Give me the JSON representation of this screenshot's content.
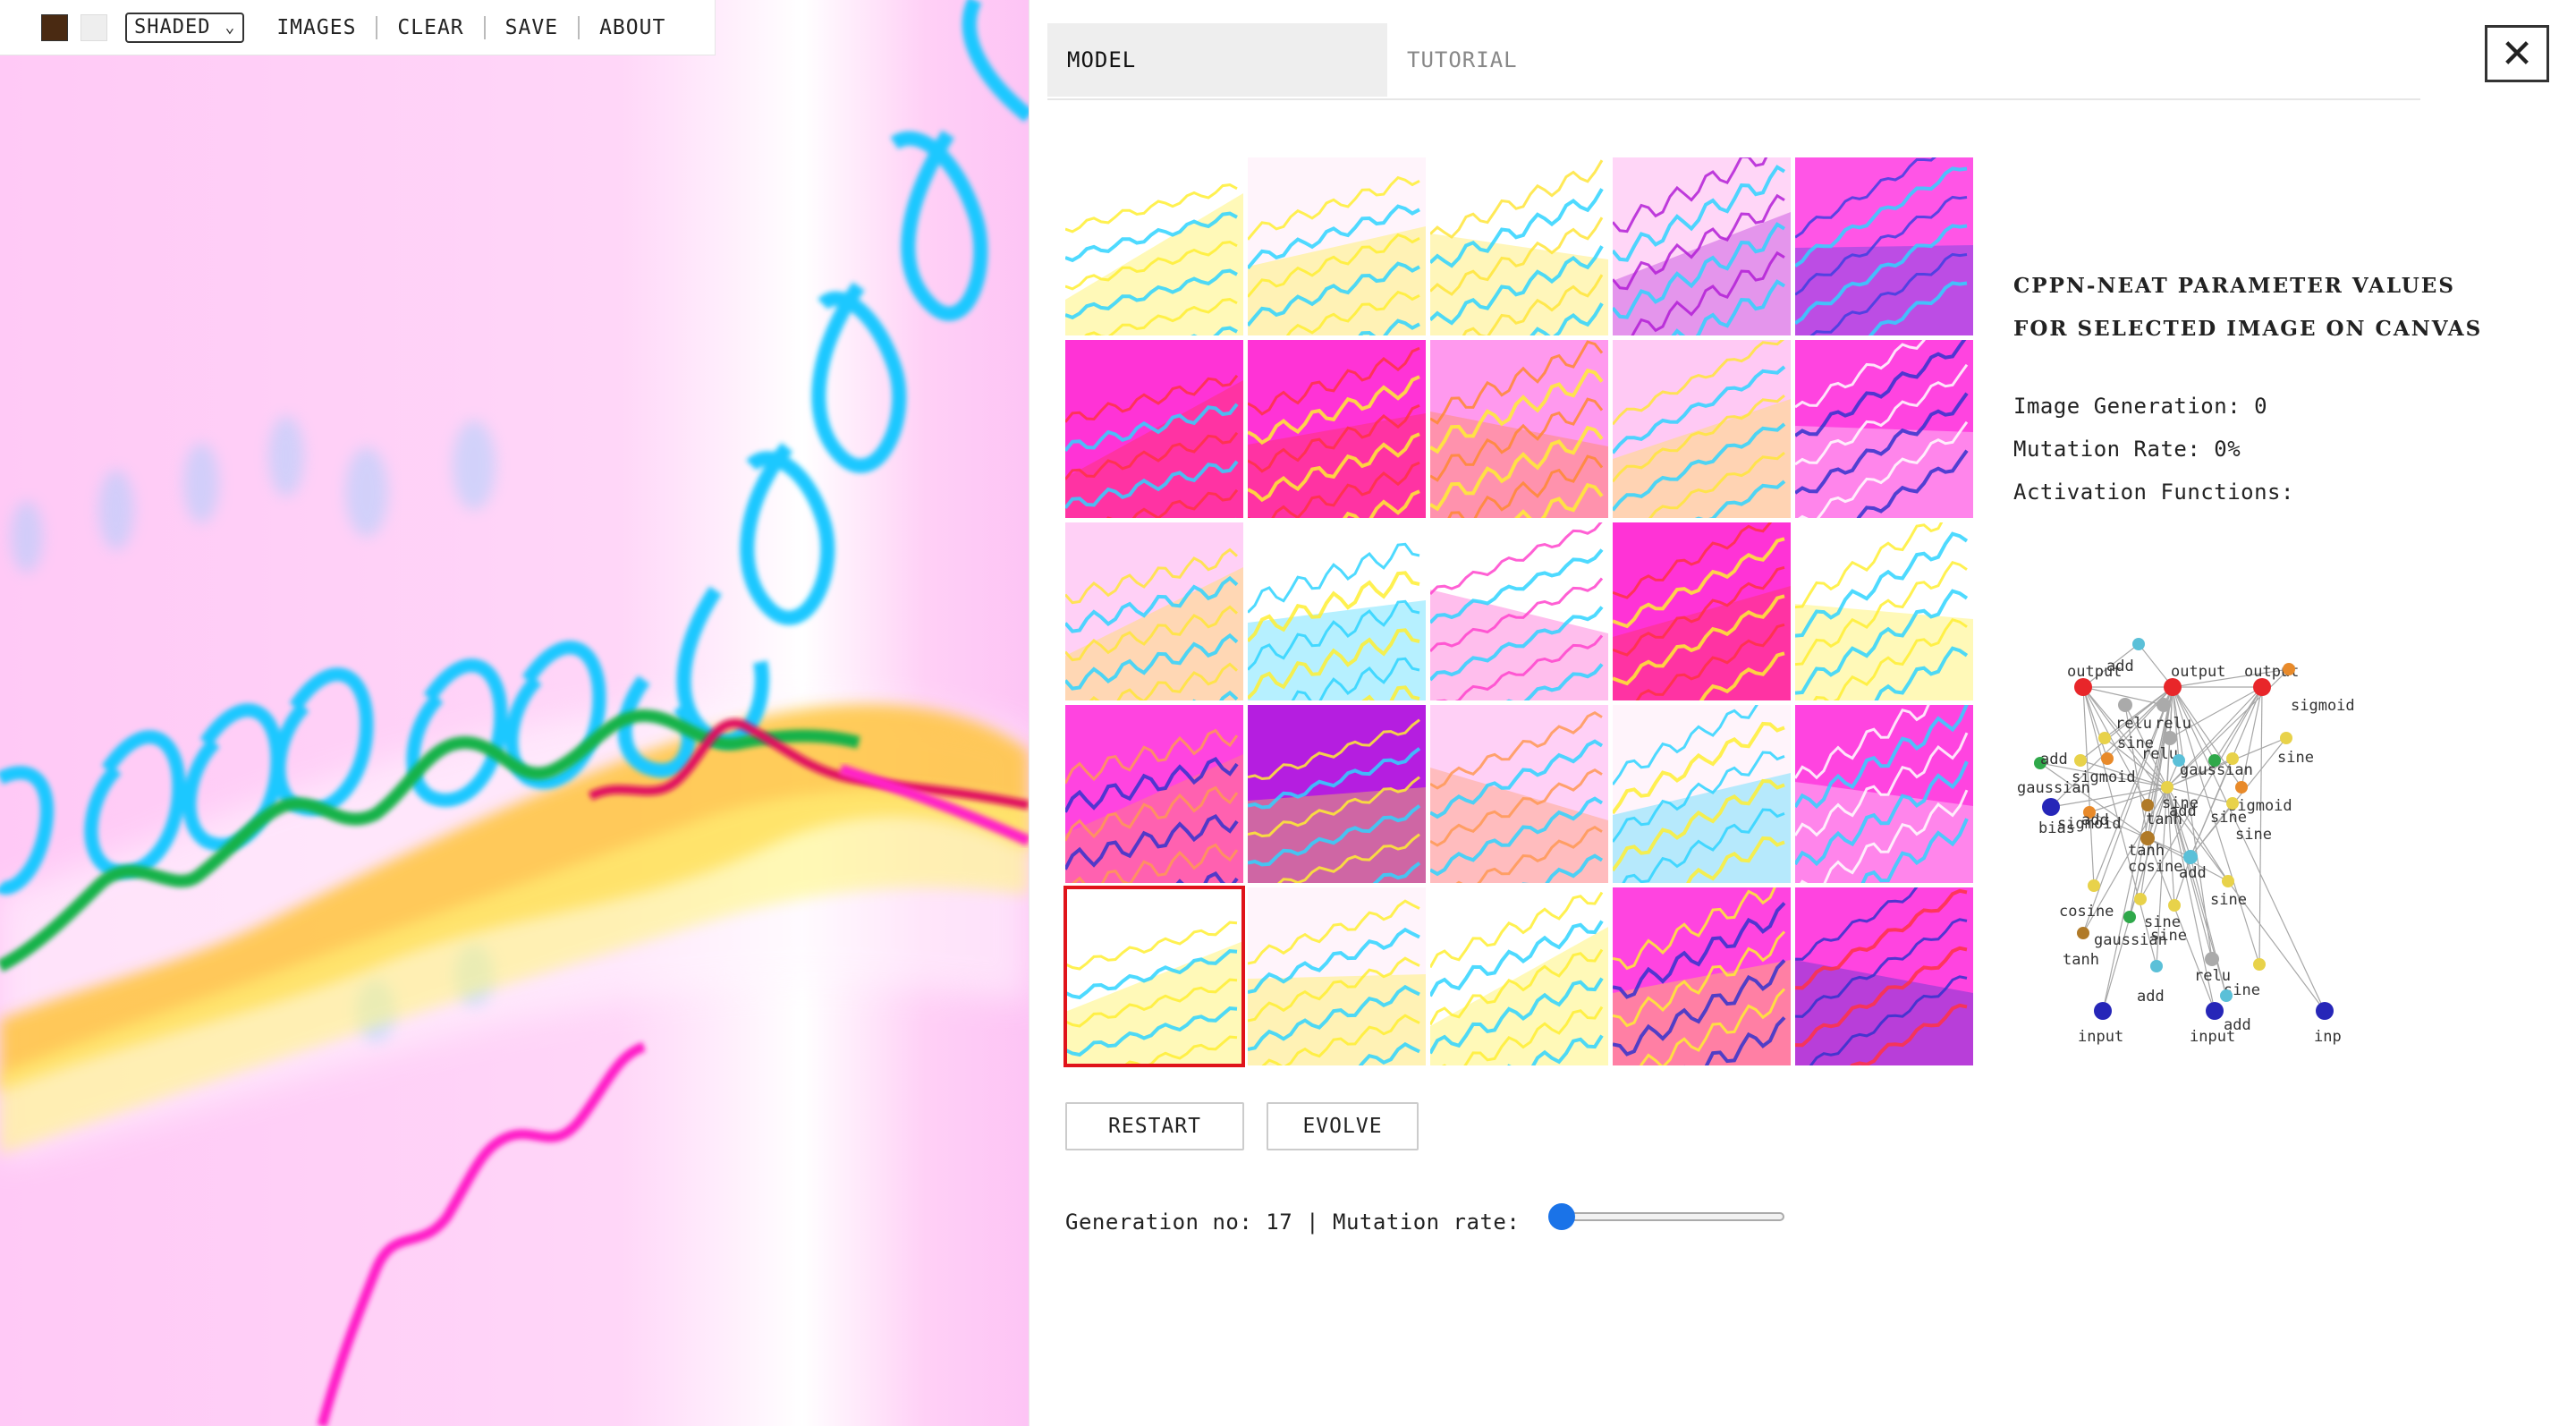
{
  "toolbar": {
    "colors": {
      "primary": "#4a2a12",
      "secondary": "#eeeeee"
    },
    "mode": "SHADED",
    "links": [
      "IMAGES",
      "CLEAR",
      "SAVE",
      "ABOUT"
    ]
  },
  "tabs": {
    "model": "MODEL",
    "tutorial": "TUTORIAL"
  },
  "close_label": "✕",
  "grid": {
    "rows": 5,
    "cols": 5,
    "selected_index": 20
  },
  "buttons": {
    "restart": "RESTART",
    "evolve": "EVOLVE"
  },
  "status": {
    "generation_label": "Generation no:",
    "generation": "17",
    "separator": "|",
    "mutation_label": "Mutation rate:",
    "mutation_slider_value": 0
  },
  "info": {
    "title_line1": "CPPN-NEAT PARAMETER VALUES",
    "title_line2": "FOR SELECTED IMAGE ON CANVAS",
    "image_generation": "Image Generation: 0",
    "mutation_rate": "Mutation Rate: 0%",
    "activation_functions": "Activation Functions:"
  },
  "network": {
    "labels": [
      "output",
      "add",
      "output",
      "output",
      "sigmoid",
      "relu",
      "relu",
      "sine",
      "relu",
      "sine",
      "gaussian",
      "sine",
      "sigmoid",
      "gaussian",
      "add",
      "add",
      "sine",
      "sigmoid",
      "bias",
      "sigmoid",
      "tanh",
      "sine",
      "tanh",
      "cosine",
      "add",
      "cosine",
      "sine",
      "gaussian",
      "sine",
      "tanh",
      "relu",
      "sine",
      "add",
      "add",
      "input",
      "input",
      "inp"
    ]
  },
  "colors": {
    "accent": "#1a73e8",
    "selected": "#e0131a"
  }
}
